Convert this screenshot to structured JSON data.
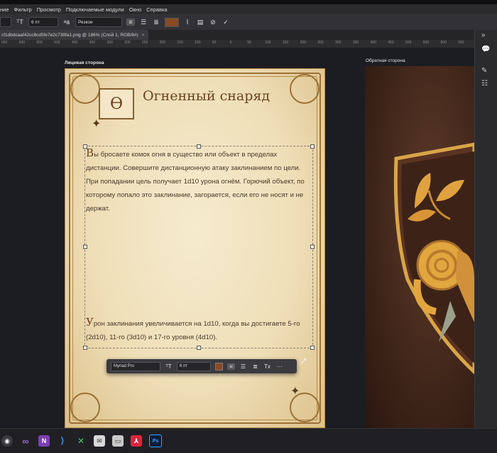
{
  "menu": {
    "items": [
      "ние",
      "Фильтр",
      "Просмотр",
      "Подключаемые модули",
      "Окно",
      "Справка"
    ]
  },
  "options_bar": {
    "font_size": "6 пт",
    "tracking_icon_label": "ᵃa",
    "antialias": "Резкое"
  },
  "doc_tab": {
    "title": "cf1dbdcaaf42cc8cd5fe7e2c738fa1.png @ 186% (Слой 1, RGB/8#)",
    "close": "×"
  },
  "ruler": {
    "ticks": [
      "650",
      "600",
      "550",
      "500",
      "450",
      "400",
      "350",
      "300",
      "250",
      "200",
      "150",
      "100",
      "50",
      "0",
      "50",
      "100",
      "150",
      "200",
      "250",
      "300",
      "350",
      "400",
      "450",
      "500",
      "550",
      "600",
      "650"
    ]
  },
  "artboards": {
    "front_label": "Лицевая сторона",
    "back_label": "Обратная сторона"
  },
  "card": {
    "icon_glyph": "Ө",
    "title": "Огненный снаряд",
    "paragraph1_dropcap": "В",
    "paragraph1_rest": "ы бросаете комок огня в существо или объект в пределах дистанции. Совершите дистанционную атаку заклинанием по цели. При попадании цель получает 1d10 урона огнём. Горючий объект, по которому попало это заклинание, загорается, если его не носят и не держат.",
    "paragraph2_dropcap": "У",
    "paragraph2_rest": "рон заклинания увеличивается на 1d10, когда вы достигаете 5-го (2d10), 11-го (3d10) и 17-го уровня (4d10)."
  },
  "float_toolbar": {
    "font_family": "Myriad Pro",
    "font_size": "6 пт",
    "color": "#8a4a22",
    "more": "···"
  },
  "colors": {
    "ui_dark": "#2b2b2e",
    "canvas": "#1c1d22",
    "parchment": "#f6ebcf",
    "ink_brown": "#6a4420",
    "back_brown": "#3f2519",
    "accent_swatch": "#8a4a22"
  },
  "icons": {
    "menu_icon": "photoshop",
    "taskbar": [
      "windows-start",
      "visual-studio",
      "onenote",
      "vscode",
      "git-tool",
      "mail",
      "files",
      "acrobat",
      "photoshop"
    ]
  },
  "taskbar": {
    "ps_label": "Ps"
  }
}
